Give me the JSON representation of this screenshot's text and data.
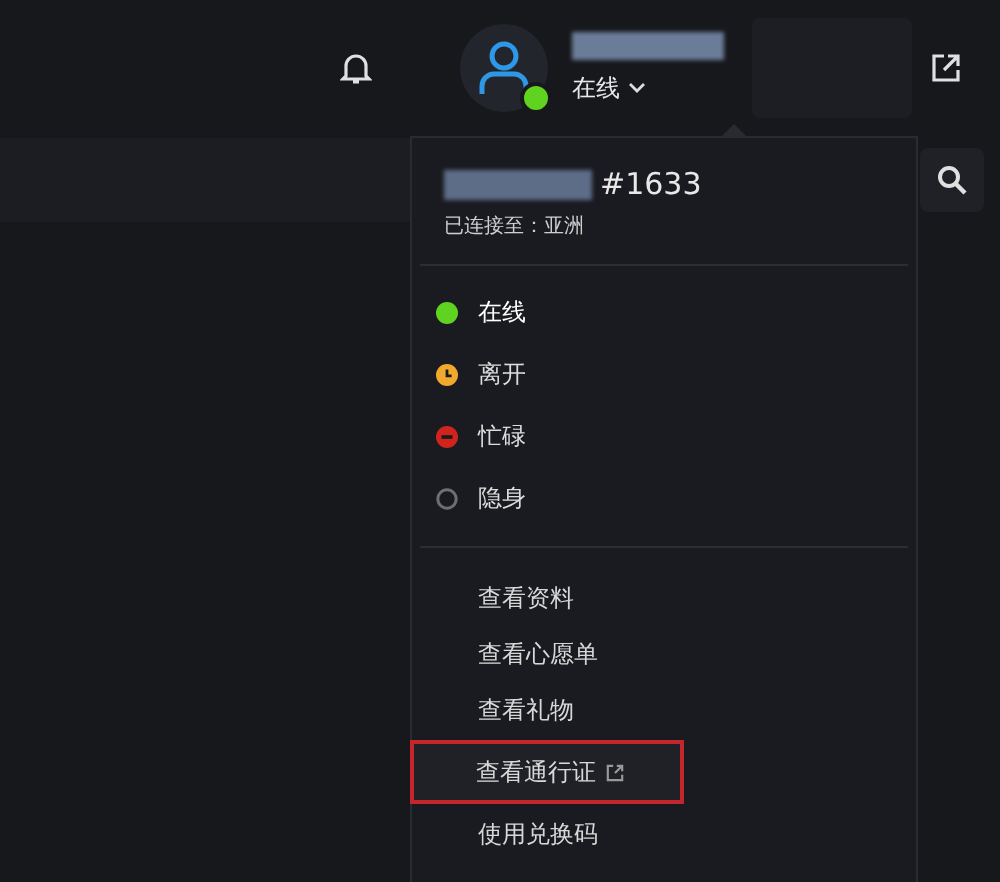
{
  "header": {
    "status": "在线"
  },
  "menu": {
    "tag": "#1633",
    "connection": "已连接至：亚洲",
    "statuses": [
      {
        "label": "在线",
        "kind": "online",
        "selected": true
      },
      {
        "label": "离开",
        "kind": "away",
        "selected": false
      },
      {
        "label": "忙碌",
        "kind": "busy",
        "selected": false
      },
      {
        "label": "隐身",
        "kind": "invisible",
        "selected": false
      }
    ],
    "links": [
      {
        "label": "查看资料",
        "external": false,
        "highlighted": false
      },
      {
        "label": "查看心愿单",
        "external": false,
        "highlighted": false
      },
      {
        "label": "查看礼物",
        "external": false,
        "highlighted": false
      },
      {
        "label": "查看通行证",
        "external": true,
        "highlighted": true
      },
      {
        "label": "使用兑换码",
        "external": false,
        "highlighted": false
      }
    ]
  }
}
